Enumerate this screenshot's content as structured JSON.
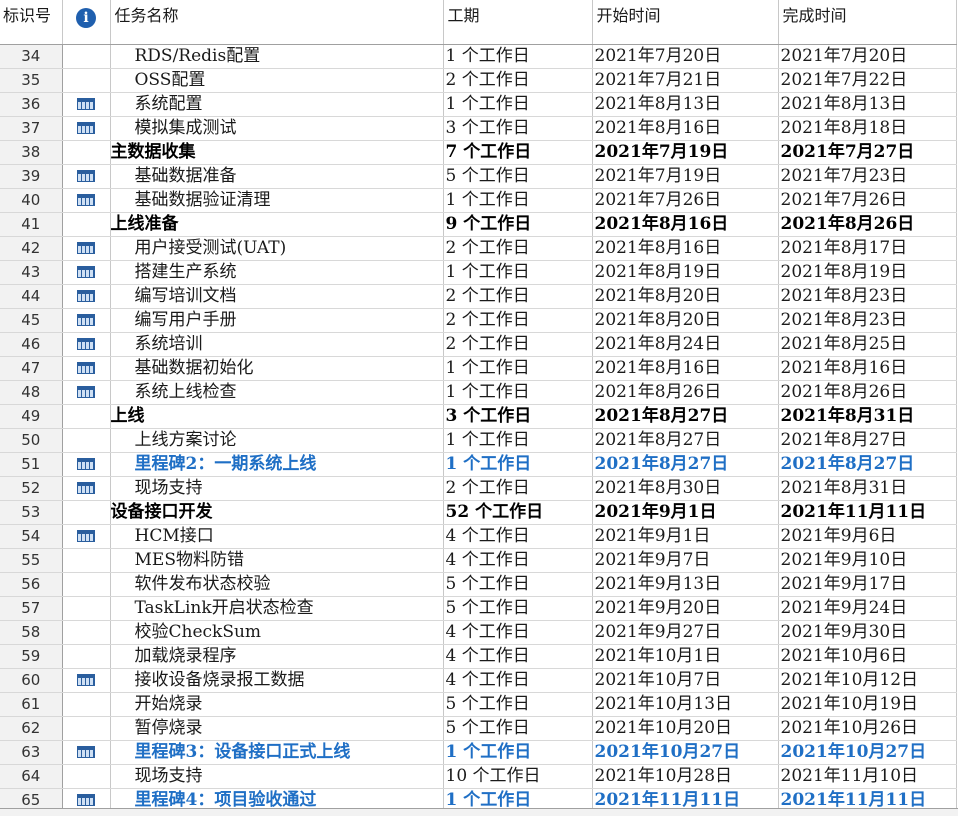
{
  "headers": {
    "id": "标识号",
    "name": "任务名称",
    "duration": "工期",
    "start": "开始时间",
    "finish": "完成时间",
    "indicator_icon": "info-icon"
  },
  "rows": [
    {
      "id": "34",
      "name": "RDS/Redis配置",
      "duration": "1 个工作日",
      "start": "2021年7月20日",
      "finish": "2021年7月20日",
      "level": 1,
      "type": "task",
      "icon": ""
    },
    {
      "id": "35",
      "name": "OSS配置",
      "duration": "2 个工作日",
      "start": "2021年7月21日",
      "finish": "2021年7月22日",
      "level": 1,
      "type": "task",
      "icon": ""
    },
    {
      "id": "36",
      "name": "系统配置",
      "duration": "1 个工作日",
      "start": "2021年8月13日",
      "finish": "2021年8月13日",
      "level": 1,
      "type": "task",
      "icon": "calendar-icon"
    },
    {
      "id": "37",
      "name": "模拟集成测试",
      "duration": "3 个工作日",
      "start": "2021年8月16日",
      "finish": "2021年8月18日",
      "level": 1,
      "type": "task",
      "icon": "calendar-icon"
    },
    {
      "id": "38",
      "name": "主数据收集",
      "duration": "7 个工作日",
      "start": "2021年7月19日",
      "finish": "2021年7月27日",
      "level": 0,
      "type": "summary",
      "icon": ""
    },
    {
      "id": "39",
      "name": "基础数据准备",
      "duration": "5 个工作日",
      "start": "2021年7月19日",
      "finish": "2021年7月23日",
      "level": 1,
      "type": "task",
      "icon": "calendar-icon"
    },
    {
      "id": "40",
      "name": "基础数据验证清理",
      "duration": "1 个工作日",
      "start": "2021年7月26日",
      "finish": "2021年7月26日",
      "level": 1,
      "type": "task",
      "icon": "calendar-icon"
    },
    {
      "id": "41",
      "name": "上线准备",
      "duration": "9 个工作日",
      "start": "2021年8月16日",
      "finish": "2021年8月26日",
      "level": 0,
      "type": "summary",
      "icon": ""
    },
    {
      "id": "42",
      "name": "用户接受测试(UAT)",
      "duration": "2 个工作日",
      "start": "2021年8月16日",
      "finish": "2021年8月17日",
      "level": 1,
      "type": "task",
      "icon": "calendar-icon"
    },
    {
      "id": "43",
      "name": "搭建生产系统",
      "duration": "1 个工作日",
      "start": "2021年8月19日",
      "finish": "2021年8月19日",
      "level": 1,
      "type": "task",
      "icon": "calendar-icon"
    },
    {
      "id": "44",
      "name": "编写培训文档",
      "duration": "2 个工作日",
      "start": "2021年8月20日",
      "finish": "2021年8月23日",
      "level": 1,
      "type": "task",
      "icon": "calendar-icon"
    },
    {
      "id": "45",
      "name": "编写用户手册",
      "duration": "2 个工作日",
      "start": "2021年8月20日",
      "finish": "2021年8月23日",
      "level": 1,
      "type": "task",
      "icon": "calendar-icon"
    },
    {
      "id": "46",
      "name": "系统培训",
      "duration": "2 个工作日",
      "start": "2021年8月24日",
      "finish": "2021年8月25日",
      "level": 1,
      "type": "task",
      "icon": "calendar-icon"
    },
    {
      "id": "47",
      "name": "基础数据初始化",
      "duration": "1 个工作日",
      "start": "2021年8月16日",
      "finish": "2021年8月16日",
      "level": 1,
      "type": "task",
      "icon": "calendar-icon"
    },
    {
      "id": "48",
      "name": "系统上线检查",
      "duration": "1 个工作日",
      "start": "2021年8月26日",
      "finish": "2021年8月26日",
      "level": 1,
      "type": "task",
      "icon": "calendar-icon"
    },
    {
      "id": "49",
      "name": "上线",
      "duration": "3 个工作日",
      "start": "2021年8月27日",
      "finish": "2021年8月31日",
      "level": 0,
      "type": "summary",
      "icon": ""
    },
    {
      "id": "50",
      "name": "上线方案讨论",
      "duration": "1 个工作日",
      "start": "2021年8月27日",
      "finish": "2021年8月27日",
      "level": 1,
      "type": "task",
      "icon": ""
    },
    {
      "id": "51",
      "name": "里程碑2：一期系统上线",
      "duration": "1 个工作日",
      "start": "2021年8月27日",
      "finish": "2021年8月27日",
      "level": 1,
      "type": "milestone",
      "icon": "calendar-icon"
    },
    {
      "id": "52",
      "name": "现场支持",
      "duration": "2 个工作日",
      "start": "2021年8月30日",
      "finish": "2021年8月31日",
      "level": 1,
      "type": "task",
      "icon": "calendar-icon"
    },
    {
      "id": "53",
      "name": "设备接口开发",
      "duration": "52 个工作日",
      "start": "2021年9月1日",
      "finish": "2021年11月11日",
      "level": 0,
      "type": "summary",
      "icon": ""
    },
    {
      "id": "54",
      "name": "HCM接口",
      "duration": "4 个工作日",
      "start": "2021年9月1日",
      "finish": "2021年9月6日",
      "level": 1,
      "type": "task",
      "icon": "calendar-icon"
    },
    {
      "id": "55",
      "name": "MES物料防错",
      "duration": "4 个工作日",
      "start": "2021年9月7日",
      "finish": "2021年9月10日",
      "level": 1,
      "type": "task",
      "icon": ""
    },
    {
      "id": "56",
      "name": "软件发布状态校验",
      "duration": "5 个工作日",
      "start": "2021年9月13日",
      "finish": "2021年9月17日",
      "level": 1,
      "type": "task",
      "icon": ""
    },
    {
      "id": "57",
      "name": "TaskLink开启状态检查",
      "duration": "5 个工作日",
      "start": "2021年9月20日",
      "finish": "2021年9月24日",
      "level": 1,
      "type": "task",
      "icon": ""
    },
    {
      "id": "58",
      "name": "校验CheckSum",
      "duration": "4 个工作日",
      "start": "2021年9月27日",
      "finish": "2021年9月30日",
      "level": 1,
      "type": "task",
      "icon": ""
    },
    {
      "id": "59",
      "name": "加载烧录程序",
      "duration": "4 个工作日",
      "start": "2021年10月1日",
      "finish": "2021年10月6日",
      "level": 1,
      "type": "task",
      "icon": ""
    },
    {
      "id": "60",
      "name": "接收设备烧录报工数据",
      "duration": "4 个工作日",
      "start": "2021年10月7日",
      "finish": "2021年10月12日",
      "level": 1,
      "type": "task",
      "icon": "calendar-icon"
    },
    {
      "id": "61",
      "name": "开始烧录",
      "duration": "5 个工作日",
      "start": "2021年10月13日",
      "finish": "2021年10月19日",
      "level": 1,
      "type": "task",
      "icon": ""
    },
    {
      "id": "62",
      "name": "暂停烧录",
      "duration": "5 个工作日",
      "start": "2021年10月20日",
      "finish": "2021年10月26日",
      "level": 1,
      "type": "task",
      "icon": ""
    },
    {
      "id": "63",
      "name": "里程碑3：设备接口正式上线",
      "duration": "1 个工作日",
      "start": "2021年10月27日",
      "finish": "2021年10月27日",
      "level": 1,
      "type": "milestone",
      "icon": "calendar-icon"
    },
    {
      "id": "64",
      "name": "现场支持",
      "duration": "10 个工作日",
      "start": "2021年10月28日",
      "finish": "2021年11月10日",
      "level": 1,
      "type": "task",
      "icon": ""
    },
    {
      "id": "65",
      "name": "里程碑4：项目验收通过",
      "duration": "1 个工作日",
      "start": "2021年11月11日",
      "finish": "2021年11月11日",
      "level": 1,
      "type": "milestone",
      "icon": "calendar-icon"
    }
  ]
}
